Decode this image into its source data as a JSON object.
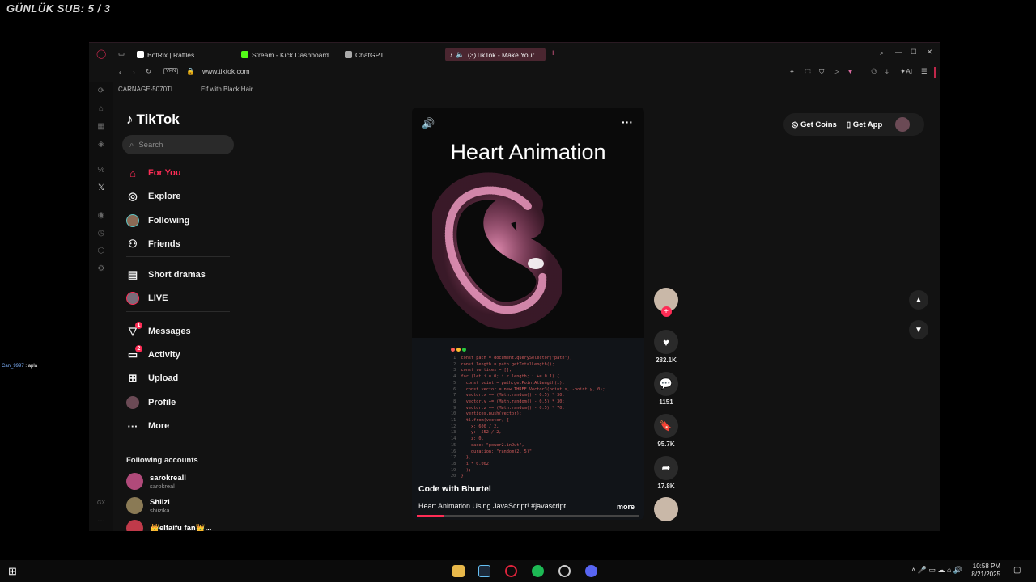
{
  "overlay": {
    "sub_counter": "GÜNLÜK SUB: 5 / 3",
    "chat_user": "Can_9997",
    "chat_text": " : apla"
  },
  "browser": {
    "tabs": [
      {
        "label": "BotRix | Raffles",
        "color": "#ffffff"
      },
      {
        "label": "Stream - Kick Dashboard",
        "color": "#53fc18"
      },
      {
        "label": "ChatGPT",
        "color": "#aaaaaa"
      },
      {
        "label": "(3)TikTok - Make Your",
        "color": "#ffffff",
        "active": true
      }
    ],
    "url": "www.tiktok.com",
    "vpn_label": "VPN",
    "ai_label": "AI",
    "bookmarks": [
      "CARNAGE-5070TI...",
      "Elf with Black Hair..."
    ]
  },
  "tiktok": {
    "logo": "TikTok",
    "search_placeholder": "Search",
    "nav": [
      {
        "label": "For You",
        "icon": "home-icon"
      },
      {
        "label": "Explore",
        "icon": "compass-icon"
      },
      {
        "label": "Following",
        "icon": "following-avatar-icon"
      },
      {
        "label": "Friends",
        "icon": "friends-icon"
      },
      {
        "label": "Short dramas",
        "icon": "film-icon"
      },
      {
        "label": "LIVE",
        "icon": "live-icon"
      },
      {
        "label": "Messages",
        "icon": "send-icon",
        "badge": "1"
      },
      {
        "label": "Activity",
        "icon": "activity-icon",
        "badge": "2"
      },
      {
        "label": "Upload",
        "icon": "upload-icon"
      },
      {
        "label": "Profile",
        "icon": "profile-avatar-icon"
      },
      {
        "label": "More",
        "icon": "more-icon"
      }
    ],
    "following_header": "Following accounts",
    "following": [
      {
        "name": "sarokreall",
        "handle": "sarokreal"
      },
      {
        "name": "Shiizi",
        "handle": "shiizika"
      },
      {
        "name": "👑elfaifu fan👑...",
        "handle": ""
      }
    ],
    "topbar": {
      "coins": "Get Coins",
      "app": "Get App"
    },
    "video": {
      "title": "Heart Animation",
      "author": "Code with Bhurtel",
      "description": "Heart Animation Using JavaScript! #javascript ...",
      "more": "more",
      "progress": 0.12,
      "code_lines": [
        "const path = document.querySelector(\"path\");",
        "const length = path.getTotalLength();",
        "const vertices = [];",
        "for (let i = 0; i < length; i += 0.1) {",
        "  const point = path.getPointAtLength(i);",
        "  const vector = new THREE.Vector3(point.x, -point.y, 0);",
        "  vector.x += (Math.random() - 0.5) * 30;",
        "  vector.y += (Math.random() - 0.5) * 30;",
        "  vector.z += (Math.random() - 0.5) * 70;",
        "  vertices.push(vector);",
        "  tl.from(vector, {",
        "    x: 600 / 2,",
        "    y: -552 / 2,",
        "    z: 0,",
        "    ease: \"power2.inOut\",",
        "    duration: \"random(2, 5)\"",
        "  },",
        "  i * 0.002",
        "  );",
        "}"
      ]
    },
    "actions": {
      "likes": "282.1K",
      "comments": "1151",
      "saves": "95.7K",
      "shares": "17.8K"
    }
  },
  "taskbar": {
    "time": "10:58 PM",
    "date": "8/21/2025"
  }
}
